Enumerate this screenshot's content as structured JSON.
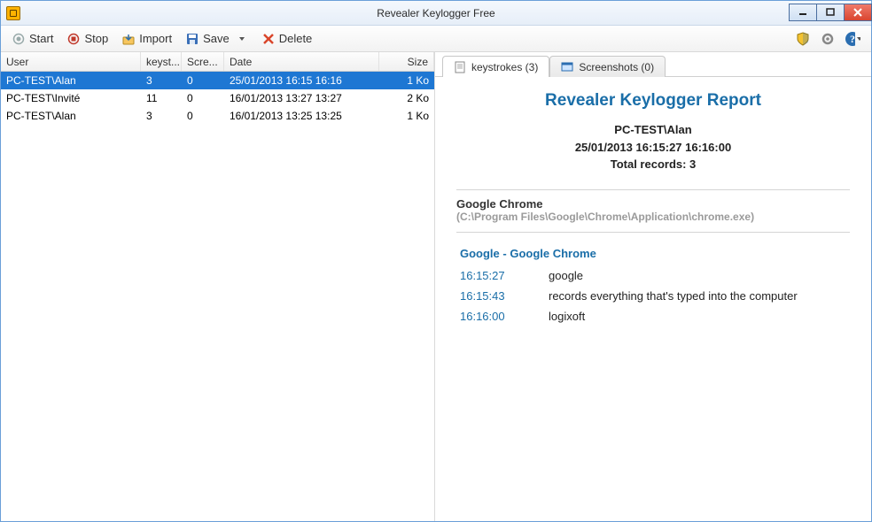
{
  "title": "Revealer Keylogger Free",
  "toolbar": {
    "start": "Start",
    "stop": "Stop",
    "import": "Import",
    "save": "Save",
    "delete": "Delete"
  },
  "grid": {
    "headers": {
      "user": "User",
      "keystrokes": "keyst...",
      "screenshots": "Scre...",
      "date": "Date",
      "size": "Size"
    },
    "rows": [
      {
        "user": "PC-TEST\\Alan",
        "keystrokes": "3",
        "screenshots": "0",
        "date": "25/01/2013  16:15  16:16",
        "size": "1 Ko",
        "selected": true
      },
      {
        "user": "PC-TEST\\Invité",
        "keystrokes": "11",
        "screenshots": "0",
        "date": "16/01/2013  13:27  13:27",
        "size": "2 Ko",
        "selected": false
      },
      {
        "user": "PC-TEST\\Alan",
        "keystrokes": "3",
        "screenshots": "0",
        "date": "16/01/2013  13:25  13:25",
        "size": "1 Ko",
        "selected": false
      }
    ]
  },
  "tabs": {
    "keystrokes_label": "keystrokes (3)",
    "screenshots_label": "Screenshots (0)"
  },
  "report": {
    "title": "Revealer Keylogger Report",
    "user": "PC-TEST\\Alan",
    "daterange": "25/01/2013 16:15:27 16:16:00",
    "total": "Total records: 3",
    "app_name": "Google Chrome",
    "app_path": "(C:\\Program Files\\Google\\Chrome\\Application\\chrome.exe)",
    "session": "Google - Google Chrome",
    "entries": [
      {
        "time": "16:15:27",
        "text": "google"
      },
      {
        "time": "16:15:43",
        "text": "records everything that's typed into the computer"
      },
      {
        "time": "16:16:00",
        "text": "logixoft"
      }
    ]
  }
}
